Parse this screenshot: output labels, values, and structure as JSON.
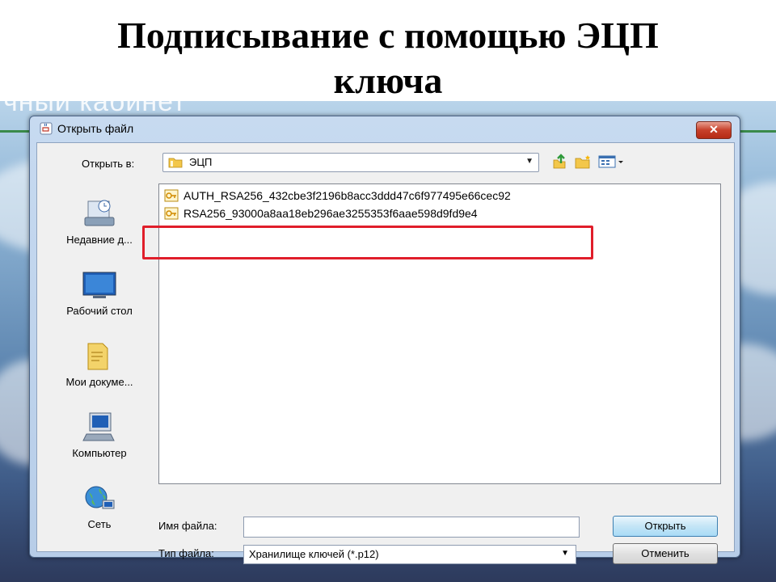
{
  "slide": {
    "title_line1": "Подписывание с помощью ЭЦП",
    "title_line2": "ключа"
  },
  "background": {
    "cabinet_text": "чный кабинет"
  },
  "dialog": {
    "title": "Открыть файл",
    "close_label": "✕",
    "look_in_label": "Открыть в:",
    "look_in_value": "ЭЦП",
    "places": [
      {
        "label": "Недавние д..."
      },
      {
        "label": "Рабочий стол"
      },
      {
        "label": "Мои докуме..."
      },
      {
        "label": "Компьютер"
      },
      {
        "label": "Сеть"
      }
    ],
    "files": [
      {
        "name": "AUTH_RSA256_432cbe3f2196b8acc3ddd47c6f977495e66cec92"
      },
      {
        "name": "RSA256_93000a8aa18eb296ae3255353f6aae598d9fd9e4"
      }
    ],
    "file_name_label": "Имя файла:",
    "file_name_value": "",
    "file_type_label": "Тип файла:",
    "file_type_value": "Хранилище ключей (*.p12)",
    "open_button": "Открыть",
    "cancel_button": "Отменить"
  },
  "colors": {
    "highlight": "#e01e2a",
    "accent": "#c4e5f6"
  }
}
